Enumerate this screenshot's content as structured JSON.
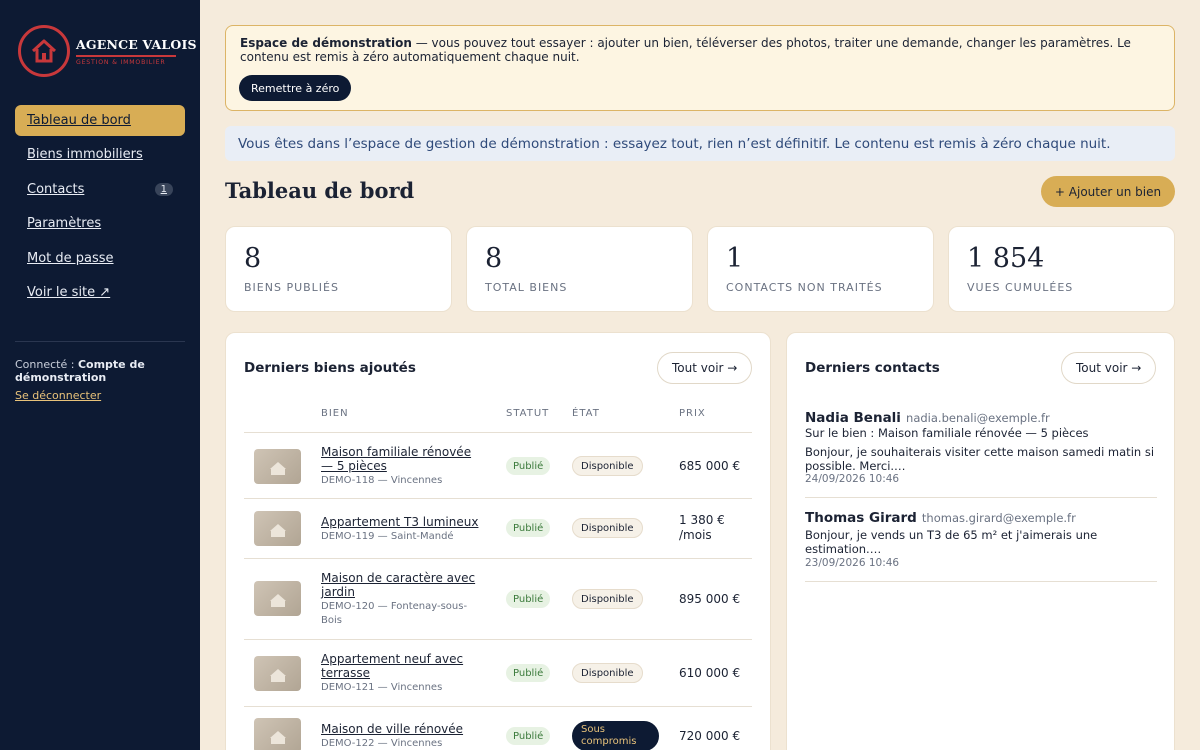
{
  "brand": {
    "name": "AGENCE VALOIS",
    "tagline": "GESTION & IMMOBILIER"
  },
  "sidebar": {
    "items": [
      {
        "label": "Tableau de bord",
        "active": true
      },
      {
        "label": "Biens immobiliers"
      },
      {
        "label": "Contacts",
        "badge": "1"
      },
      {
        "label": "Paramètres"
      },
      {
        "label": "Mot de passe"
      },
      {
        "label": "Voir le site ↗"
      }
    ],
    "connected_prefix": "Connecté : ",
    "connected_user": "Compte de démonstration",
    "logout": "Se déconnecter"
  },
  "demo_banner": {
    "title": "Espace de démonstration",
    "text": " — vous pouvez tout essayer : ajouter un bien, téléverser des photos, traiter une demande, changer les paramètres. Le contenu est remis à zéro automatiquement chaque nuit.",
    "reset_label": "Remettre à zéro"
  },
  "info_bar": "Vous êtes dans l’espace de gestion de démonstration : essayez tout, rien n’est définitif. Le contenu est remis à zéro chaque nuit.",
  "page": {
    "title": "Tableau de bord",
    "add_label": "+ Ajouter un bien"
  },
  "stats": [
    {
      "value": "8",
      "label": "BIENS PUBLIÉS"
    },
    {
      "value": "8",
      "label": "TOTAL BIENS"
    },
    {
      "value": "1",
      "label": "CONTACTS NON TRAITÉS"
    },
    {
      "value": "1 854",
      "label": "VUES CUMULÉES"
    }
  ],
  "biens": {
    "title": "Derniers biens ajoutés",
    "see_all": "Tout voir →",
    "headers": {
      "bien": "BIEN",
      "statut": "STATUT",
      "etat": "ÉTAT",
      "prix": "PRIX"
    },
    "rows": [
      {
        "name": "Maison familiale rénovée — 5 pièces",
        "ref": "DEMO-118 — Vincennes",
        "statut": "Publié",
        "etat": "Disponible",
        "prix": "685 000 €"
      },
      {
        "name": "Appartement T3 lumineux",
        "ref": "DEMO-119 — Saint-Mandé",
        "statut": "Publié",
        "etat": "Disponible",
        "prix": "1 380 € /mois"
      },
      {
        "name": "Maison de caractère avec jardin",
        "ref": "DEMO-120 — Fontenay-sous-Bois",
        "statut": "Publié",
        "etat": "Disponible",
        "prix": "895 000 €"
      },
      {
        "name": "Appartement neuf avec terrasse",
        "ref": "DEMO-121 — Vincennes",
        "statut": "Publié",
        "etat": "Disponible",
        "prix": "610 000 €"
      },
      {
        "name": "Maison de ville rénovée",
        "ref": "DEMO-122 — Vincennes",
        "statut": "Publié",
        "etat": "Sous compromis",
        "prix": "720 000 €"
      }
    ]
  },
  "contacts": {
    "title": "Derniers contacts",
    "see_all": "Tout voir →",
    "items": [
      {
        "name": "Nadia Benali",
        "email": "nadia.benali@exemple.fr",
        "subject": "Sur le bien : Maison familiale rénovée — 5 pièces",
        "message": "Bonjour, je souhaiterais visiter cette maison samedi matin si possible. Merci.…",
        "date": "24/09/2026 10:46"
      },
      {
        "name": "Thomas Girard",
        "email": "thomas.girard@exemple.fr",
        "message": "Bonjour, je vends un T3 de 65 m² et j'aimerais une estimation.…",
        "date": "23/09/2026 10:46"
      }
    ]
  },
  "colors": {
    "sidebar": "#0d1a33",
    "accent": "#d8ad55",
    "brand_red": "#c8383b",
    "background": "#f5ebdc"
  }
}
